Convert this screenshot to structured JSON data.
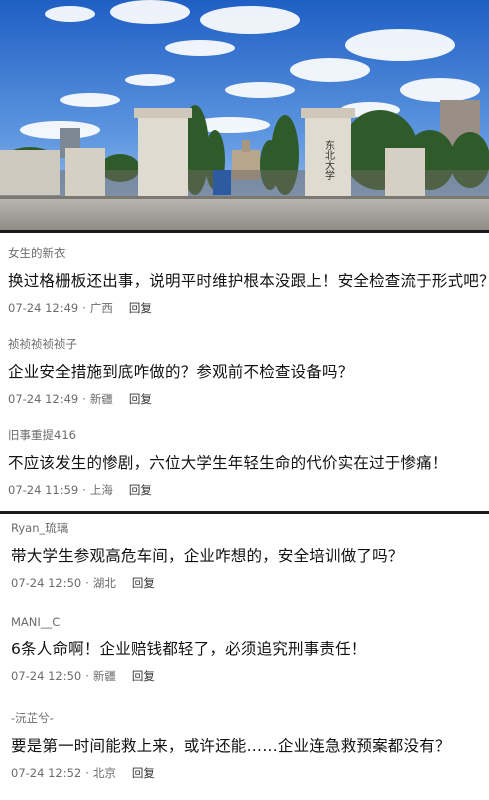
{
  "comments_top": [
    {
      "user": "女生的新衣",
      "text": "换过格栅板还出事，说明平时维护根本没跟上！安全检查流于形式吧？",
      "time": "07-24 12:49",
      "location": "广西",
      "reply": "回复"
    },
    {
      "user": "祯祯祯祯祯子",
      "text": "企业安全措施到底咋做的？参观前不检查设备吗？",
      "time": "07-24 12:49",
      "location": "新疆",
      "reply": "回复"
    },
    {
      "user": "旧事重提416",
      "text": "不应该发生的惨剧，六位大学生年轻生命的代价实在过于惨痛！",
      "time": "07-24 11:59",
      "location": "上海",
      "reply": "回复"
    }
  ],
  "comments_bottom": [
    {
      "user": "Ryan_琉璃",
      "text": "带大学生参观高危车间，企业咋想的，安全培训做了吗？",
      "time": "07-24 12:50",
      "location": "湖北",
      "reply": "回复"
    },
    {
      "user": "MANI__C",
      "text": "6条人命啊！企业赔钱都轻了，必须追究刑事责任！",
      "time": "07-24 12:50",
      "location": "新疆",
      "reply": "回复"
    },
    {
      "user": "-沅芷兮-",
      "text": "要是第一时间能救上来，或许还能……企业连急救预案都没有？",
      "time": "07-24 12:52",
      "location": "北京",
      "reply": "回复"
    }
  ],
  "separator": "·"
}
